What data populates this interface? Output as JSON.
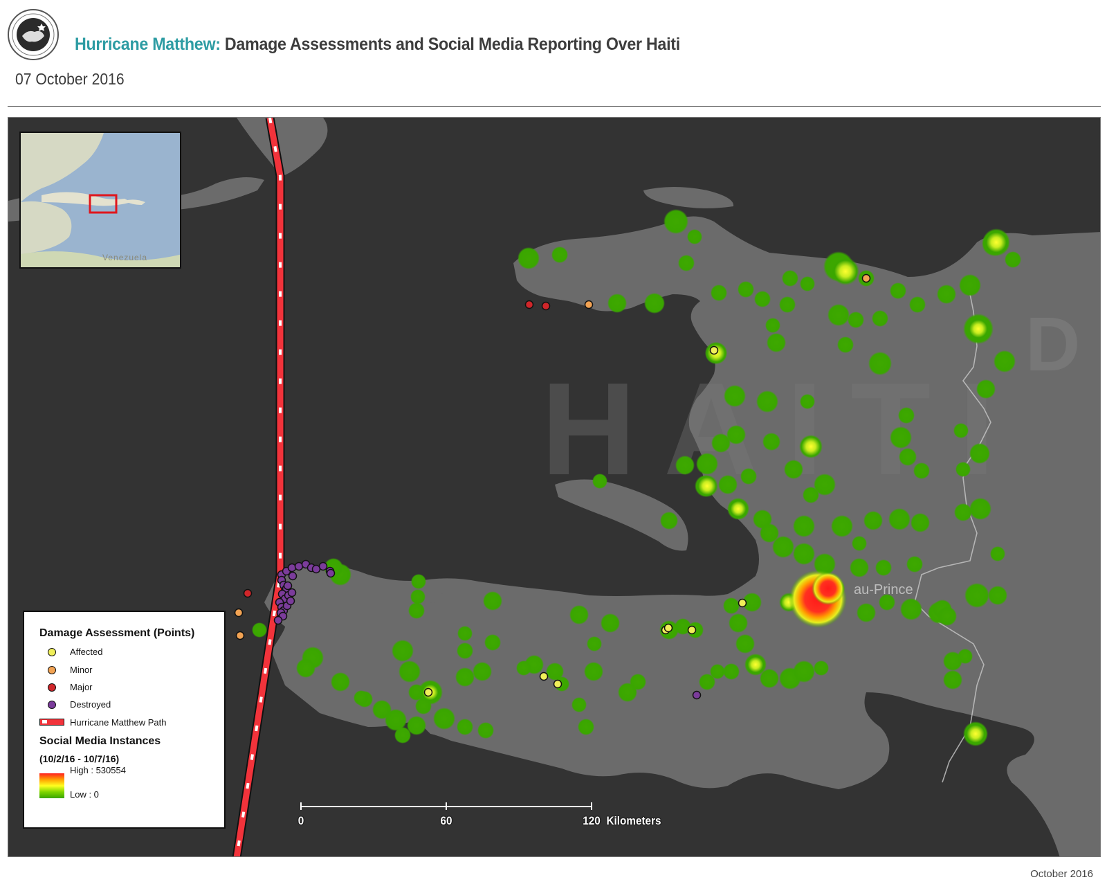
{
  "header": {
    "title_accent": "Hurricane Matthew:",
    "title_main": "Damage Assessments and Social Media Reporting Over Haiti",
    "date": "07 October 2016"
  },
  "footer": {
    "text": "October 2016"
  },
  "map": {
    "watermark": "HAITI",
    "watermark_neighbor": "D",
    "city_label": "au-Prince",
    "inset_label": "Venezuela",
    "scale_bar": {
      "ticks": [
        "0",
        "60",
        "120"
      ],
      "unit": "Kilometers"
    }
  },
  "legend": {
    "damage_title": "Damage Assessment (Points)",
    "damage_items": [
      {
        "label": "Affected",
        "color": "#f0ef5a"
      },
      {
        "label": "Minor",
        "color": "#f2a353"
      },
      {
        "label": "Major",
        "color": "#d0262a"
      },
      {
        "label": "Destroyed",
        "color": "#7b3c9b"
      }
    ],
    "path_label": "Hurricane Matthew Path",
    "social_title": "Social Media Instances",
    "social_range": "(10/2/16 - 10/7/16)",
    "high_label": "High : 530554",
    "low_label": "Low : 0"
  },
  "colors": {
    "accent": "#2d9ca3",
    "sea": "#333333",
    "land": "#6b6b6b",
    "heat_low": "#3aa600",
    "heat_high": "#ff2020",
    "path": "#f2333b"
  }
}
